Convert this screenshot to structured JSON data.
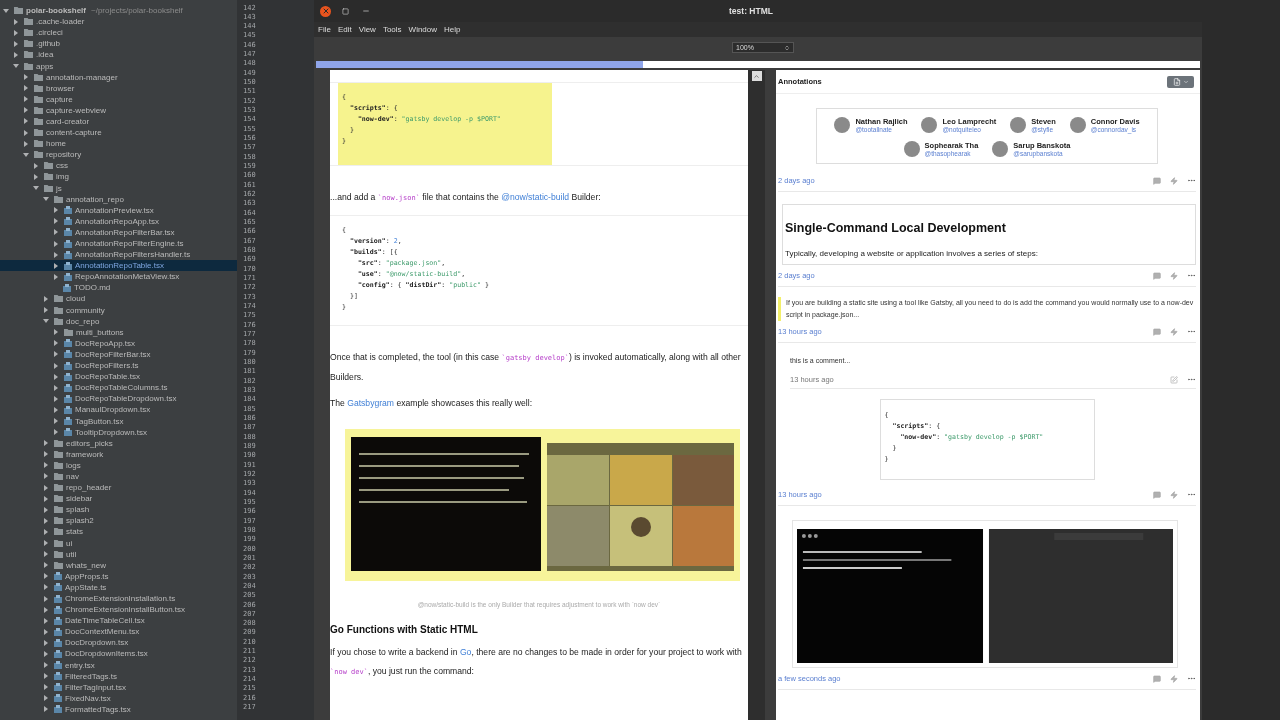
{
  "project_tree": [
    {
      "label": "polar-bookshelf",
      "path": "~/projects/polar-bookshelf",
      "kind": "project",
      "expanded": true,
      "selected": false,
      "children": [
        {
          "label": ".cache-loader",
          "kind": "folder",
          "expanded": false,
          "selected": false
        },
        {
          "label": ".circleci",
          "kind": "folder",
          "expanded": false,
          "selected": false
        },
        {
          "label": ".github",
          "kind": "folder",
          "expanded": false,
          "selected": false
        },
        {
          "label": ".idea",
          "kind": "folder",
          "expanded": false,
          "selected": false
        },
        {
          "label": "apps",
          "kind": "folder",
          "expanded": true,
          "selected": false,
          "children": [
            {
              "label": "annotation-manager",
              "kind": "folder",
              "expanded": false,
              "selected": false
            },
            {
              "label": "browser",
              "kind": "folder",
              "expanded": false,
              "selected": false
            },
            {
              "label": "capture",
              "kind": "folder",
              "expanded": false,
              "selected": false
            },
            {
              "label": "capture-webview",
              "kind": "folder",
              "expanded": false,
              "selected": false
            },
            {
              "label": "card-creator",
              "kind": "folder",
              "expanded": false,
              "selected": false
            },
            {
              "label": "content-capture",
              "kind": "folder",
              "expanded": false,
              "selected": false
            },
            {
              "label": "home",
              "kind": "folder",
              "expanded": false,
              "selected": false
            },
            {
              "label": "repository",
              "kind": "folder",
              "expanded": true,
              "selected": false,
              "children": [
                {
                  "label": "css",
                  "kind": "folder",
                  "expanded": false,
                  "selected": false
                },
                {
                  "label": "img",
                  "kind": "folder",
                  "expanded": false,
                  "selected": false
                },
                {
                  "label": "js",
                  "kind": "folder",
                  "expanded": true,
                  "selected": false,
                  "children": [
                    {
                      "label": "annotation_repo",
                      "kind": "folder",
                      "expanded": true,
                      "selected": false,
                      "children": [
                        {
                          "label": "AnnotationPreview.tsx",
                          "kind": "file",
                          "expanded": false,
                          "selected": false
                        },
                        {
                          "label": "AnnotationRepoApp.tsx",
                          "kind": "file",
                          "expanded": false,
                          "selected": false
                        },
                        {
                          "label": "AnnotationRepoFilterBar.tsx",
                          "kind": "file",
                          "expanded": false,
                          "selected": false
                        },
                        {
                          "label": "AnnotationRepoFilterEngine.ts",
                          "kind": "file",
                          "expanded": false,
                          "selected": false
                        },
                        {
                          "label": "AnnotationRepoFiltersHandler.ts",
                          "kind": "file",
                          "expanded": false,
                          "selected": false
                        },
                        {
                          "label": "AnnotationRepoTable.tsx",
                          "kind": "file",
                          "expanded": false,
                          "selected": true
                        },
                        {
                          "label": "RepoAnnotationMetaView.tsx",
                          "kind": "file",
                          "expanded": false,
                          "selected": false
                        },
                        {
                          "label": "TODO.md",
                          "kind": "file",
                          "selected": false
                        }
                      ]
                    },
                    {
                      "label": "cloud",
                      "kind": "folder",
                      "expanded": false,
                      "selected": false
                    },
                    {
                      "label": "community",
                      "kind": "folder",
                      "expanded": false,
                      "selected": false
                    },
                    {
                      "label": "doc_repo",
                      "kind": "folder",
                      "expanded": true,
                      "selected": false,
                      "children": [
                        {
                          "label": "multi_buttons",
                          "kind": "folder",
                          "expanded": false,
                          "selected": false
                        },
                        {
                          "label": "DocRepoApp.tsx",
                          "kind": "file",
                          "expanded": false,
                          "selected": false
                        },
                        {
                          "label": "DocRepoFilterBar.tsx",
                          "kind": "file",
                          "expanded": false,
                          "selected": false
                        },
                        {
                          "label": "DocRepoFilters.ts",
                          "kind": "file",
                          "expanded": false,
                          "selected": false
                        },
                        {
                          "label": "DocRepoTable.tsx",
                          "kind": "file",
                          "expanded": false,
                          "selected": false
                        },
                        {
                          "label": "DocRepoTableColumns.ts",
                          "kind": "file",
                          "expanded": false,
                          "selected": false
                        },
                        {
                          "label": "DocRepoTableDropdown.tsx",
                          "kind": "file",
                          "expanded": false,
                          "selected": false
                        },
                        {
                          "label": "ManaulDropdown.tsx",
                          "kind": "file",
                          "expanded": false,
                          "selected": false
                        },
                        {
                          "label": "TagButton.tsx",
                          "kind": "file",
                          "expanded": false,
                          "selected": false
                        },
                        {
                          "label": "TooltipDropdown.tsx",
                          "kind": "file",
                          "expanded": false,
                          "selected": false
                        }
                      ]
                    },
                    {
                      "label": "editors_picks",
                      "kind": "folder",
                      "expanded": false,
                      "selected": false
                    },
                    {
                      "label": "framework",
                      "kind": "folder",
                      "expanded": false,
                      "selected": false
                    },
                    {
                      "label": "logs",
                      "kind": "folder",
                      "expanded": false,
                      "selected": false
                    },
                    {
                      "label": "nav",
                      "kind": "folder",
                      "expanded": false,
                      "selected": false
                    },
                    {
                      "label": "repo_header",
                      "kind": "folder",
                      "expanded": false,
                      "selected": false
                    },
                    {
                      "label": "sidebar",
                      "kind": "folder",
                      "expanded": false,
                      "selected": false
                    },
                    {
                      "label": "splash",
                      "kind": "folder",
                      "expanded": false,
                      "selected": false
                    },
                    {
                      "label": "splash2",
                      "kind": "folder",
                      "expanded": false,
                      "selected": false
                    },
                    {
                      "label": "stats",
                      "kind": "folder",
                      "expanded": false,
                      "selected": false
                    },
                    {
                      "label": "ui",
                      "kind": "folder",
                      "expanded": false,
                      "selected": false
                    },
                    {
                      "label": "util",
                      "kind": "folder",
                      "expanded": false,
                      "selected": false
                    },
                    {
                      "label": "whats_new",
                      "kind": "folder",
                      "expanded": false,
                      "selected": false
                    },
                    {
                      "label": "AppProps.ts",
                      "kind": "file",
                      "expanded": false,
                      "selected": false
                    },
                    {
                      "label": "AppState.ts",
                      "kind": "file",
                      "expanded": false,
                      "selected": false
                    },
                    {
                      "label": "ChromeExtensionInstallation.ts",
                      "kind": "file",
                      "expanded": false,
                      "selected": false
                    },
                    {
                      "label": "ChromeExtensionInstallButton.tsx",
                      "kind": "file",
                      "expanded": false,
                      "selected": false
                    },
                    {
                      "label": "DateTimeTableCell.tsx",
                      "kind": "file",
                      "expanded": false,
                      "selected": false
                    },
                    {
                      "label": "DocContextMenu.tsx",
                      "kind": "file",
                      "expanded": false,
                      "selected": false
                    },
                    {
                      "label": "DocDropdown.tsx",
                      "kind": "file",
                      "expanded": false,
                      "selected": false
                    },
                    {
                      "label": "DocDropdownItems.tsx",
                      "kind": "file",
                      "expanded": false,
                      "selected": false
                    },
                    {
                      "label": "entry.tsx",
                      "kind": "file",
                      "expanded": false,
                      "selected": false
                    },
                    {
                      "label": "FilteredTags.ts",
                      "kind": "file",
                      "expanded": false,
                      "selected": false
                    },
                    {
                      "label": "FilterTagInput.tsx",
                      "kind": "file",
                      "expanded": false,
                      "selected": false
                    },
                    {
                      "label": "FixedNav.tsx",
                      "kind": "file",
                      "expanded": false,
                      "selected": false
                    },
                    {
                      "label": "FormattedTags.tsx",
                      "kind": "file",
                      "expanded": false,
                      "selected": false
                    }
                  ]
                }
              ]
            }
          ]
        }
      ]
    }
  ],
  "line_numbers": [
    "142",
    "143",
    "144",
    "145",
    "146",
    "147",
    "148",
    "149",
    "150",
    "151",
    "152",
    "153",
    "154",
    "155",
    "156",
    "157",
    "158",
    "159",
    "160",
    "161",
    "162",
    "163",
    "164",
    "165",
    "166",
    "167",
    "168",
    "169",
    "170",
    "171",
    "172",
    "173",
    "174",
    "175",
    "176",
    "177",
    "178",
    "179",
    "180",
    "181",
    "182",
    "183",
    "184",
    "185",
    "186",
    "187",
    "188",
    "189",
    "190",
    "191",
    "192",
    "193",
    "194",
    "195",
    "196",
    "197",
    "198",
    "199",
    "200",
    "201",
    "202",
    "203",
    "204",
    "205",
    "206",
    "207",
    "208",
    "209",
    "210",
    "211",
    "212",
    "213",
    "214",
    "215",
    "216",
    "217"
  ],
  "window": {
    "title": "test: HTML",
    "menu": [
      "File",
      "Edit",
      "View",
      "Tools",
      "Window",
      "Help"
    ],
    "zoom": "100%",
    "progress": {
      "level": 0.37
    }
  },
  "document": [
    {
      "kind": "code",
      "highlighted": true,
      "lines": [
        "{",
        "  \"scripts\": {",
        "    \"now-dev\": \"gatsby develop -p $PORT\"",
        "  }",
        "}"
      ]
    },
    {
      "kind": "paragraph",
      "segments": [
        {
          "kind": "text",
          "text": "...and add a "
        },
        {
          "kind": "code",
          "text": "`now.json`"
        },
        {
          "kind": "text",
          "text": " file that contains the "
        },
        {
          "kind": "link",
          "text": "@now/static-build"
        },
        {
          "kind": "text",
          "text": " Builder:"
        }
      ]
    },
    {
      "kind": "code",
      "highlighted": false,
      "lines": [
        "{",
        "  \"version\": 2,",
        "  \"builds\": [{",
        "    \"src\": \"package.json\",",
        "    \"use\": \"@now/static-build\",",
        "    \"config\": { \"distDir\": \"public\" }",
        "  }]",
        "}"
      ]
    },
    {
      "kind": "paragraph",
      "segments": [
        {
          "kind": "text",
          "text": "Once that is completed, the tool (in this case "
        },
        {
          "kind": "code",
          "text": "`gatsby develop`"
        },
        {
          "kind": "text",
          "text": ") is invoked automatically, along with all other Builders."
        }
      ]
    },
    {
      "kind": "paragraph",
      "segments": [
        {
          "kind": "text",
          "text": "The "
        },
        {
          "kind": "link",
          "text": "Gatsbygram"
        },
        {
          "kind": "text",
          "text": " example showcases this really well:"
        }
      ]
    },
    {
      "kind": "picture",
      "highlighted": true,
      "caption": "@now/static-build is the only Builder that requires adjustment to work with `now dev`"
    },
    {
      "kind": "heading",
      "text": "Go Functions with Static HTML"
    },
    {
      "kind": "paragraph",
      "segments": [
        {
          "kind": "text",
          "text": "If you chose to write a backend in "
        },
        {
          "kind": "link",
          "text": "Go"
        },
        {
          "kind": "text",
          "text": ", there are no changes to be made in order for your project to work with "
        },
        {
          "kind": "code",
          "text": "`now dev`"
        },
        {
          "kind": "text",
          "text": ", you just run the command:"
        }
      ]
    }
  ],
  "annotations": {
    "title": "Annotations",
    "items": [
      {
        "kind": "contributors",
        "time": "2 days ago",
        "people": [
          {
            "name": "Nathan Rajlich",
            "handle": "@tootallnate"
          },
          {
            "name": "Leo Lamprecht",
            "handle": "@notquiteleo"
          },
          {
            "name": "Steven",
            "handle": "@styfle"
          },
          {
            "name": "Connor Davis",
            "handle": "@connordav_is"
          },
          {
            "name": "Sophearak Tha",
            "handle": "@thasophearak"
          },
          {
            "name": "Sarup Banskota",
            "handle": "@sarupbanskota"
          }
        ]
      },
      {
        "kind": "heading",
        "time": "2 days ago",
        "heading": "Single-Command Local Development",
        "text": "Typically, developing a website or application involves a series of steps:"
      },
      {
        "kind": "highlight",
        "time": "13 hours ago",
        "text": "If you are building a static site using a tool like Gatsby, all you need to do is add the command you would normally use to a now-dev script in package.json..."
      },
      {
        "kind": "comment",
        "time": "13 hours ago",
        "text": "this is a comment..."
      },
      {
        "kind": "code",
        "time": "13 hours ago",
        "lines": [
          "{",
          "  \"scripts\": {",
          "    \"now-dev\": \"gatsby develop -p $PORT\"",
          "  }",
          "}"
        ]
      },
      {
        "kind": "picture",
        "time": "a few seconds ago"
      }
    ]
  }
}
